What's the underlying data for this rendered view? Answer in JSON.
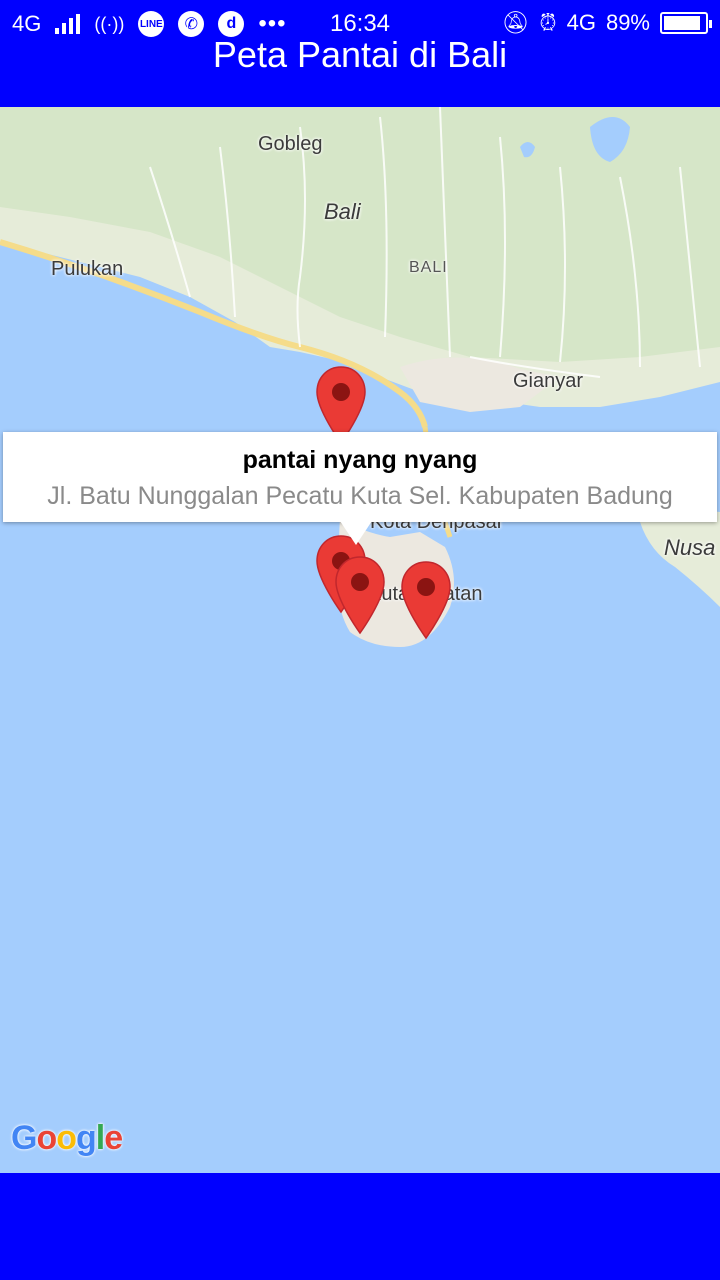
{
  "status_bar": {
    "network_left": "4G",
    "time": "16:34",
    "network_right": "4G",
    "battery_percent": "89%",
    "battery_level": 0.89,
    "icons_left": [
      "signal-icon",
      "hotspot-icon",
      "line-icon",
      "whatsapp-icon",
      "d-app-icon",
      "more-icon"
    ],
    "icons_right": [
      "mute-icon",
      "alarm-icon",
      "battery-icon"
    ]
  },
  "app_bar": {
    "title": "Peta Pantai di Bali"
  },
  "map": {
    "labels": {
      "gobleg": "Gobleg",
      "bali_italic": "Bali",
      "bali_upper": "BALI",
      "pulukan": "Pulukan",
      "gianyar": "Gianyar",
      "kota_denpasar": "Kota Denpasar",
      "nusa": "Nusa",
      "kuta_selatan": "Kuta Selatan"
    },
    "info_window": {
      "title": "pantai nyang nyang",
      "snippet": "Jl. Batu Nunggalan Pecatu Kuta Sel. Kabupaten Badung"
    },
    "marker_color": "#ea3a35",
    "water_color": "#a4cdfd",
    "land_color": "#e8eedd",
    "attribution": {
      "g1": "G",
      "o1": "o",
      "o2": "o",
      "g2": "g",
      "l": "l",
      "e": "e"
    }
  },
  "colors": {
    "bar_blue": "#0000ff"
  }
}
